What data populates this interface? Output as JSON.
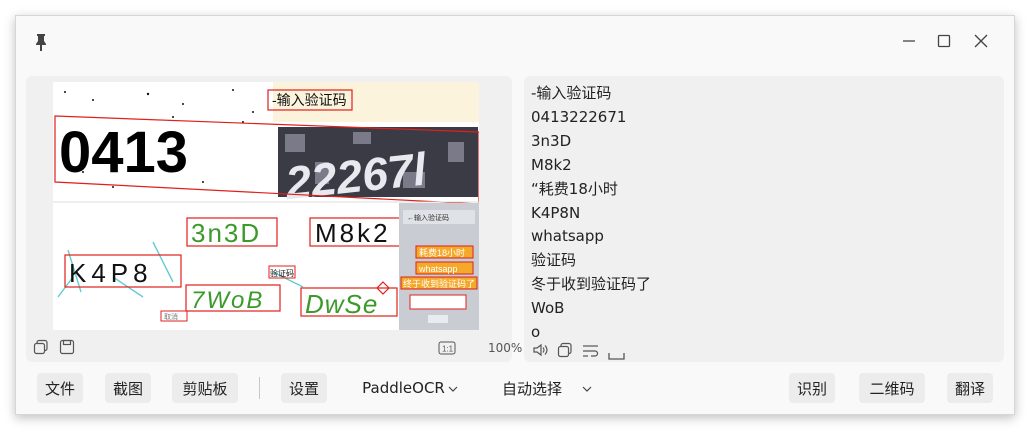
{
  "window": {
    "pin_icon": "pin-icon",
    "minimize_icon": "minimize-icon",
    "maximize_icon": "maximize-icon",
    "close_icon": "close-icon"
  },
  "image_panel": {
    "zoom": "100%",
    "captcha_texts": {
      "header": "-输入验证码",
      "digits": "0413",
      "c1": "3n3D",
      "c2": "M8k2",
      "c3": "K4P8",
      "c4": "7WoB",
      "c5": "DwSe",
      "small_label": "验证码",
      "tiny_label": "取消",
      "side_line1": "耗费18小时",
      "side_line2": "whatsapp",
      "side_line3": "终于收到验证码了",
      "side_header": "←输入验证码"
    }
  },
  "result_lines": [
    "-输入验证码",
    "0413222671",
    "3n3D",
    "M8k2",
    "“耗费18小时",
    "K4P8N",
    "whatsapp",
    "验证码",
    "冬于收到验证码了",
    "WoB",
    "o"
  ],
  "bottom": {
    "file": "文件",
    "screenshot": "截图",
    "clipboard": "剪贴板",
    "settings": "设置",
    "engine": "PaddleOCR",
    "language": "自动选择",
    "recognize": "识别",
    "qrcode": "二维码",
    "translate": "翻译"
  },
  "colors": {
    "box": "#e0201c",
    "green_text": "#3a9a2a",
    "panel_bg": "#f0f0f0"
  }
}
